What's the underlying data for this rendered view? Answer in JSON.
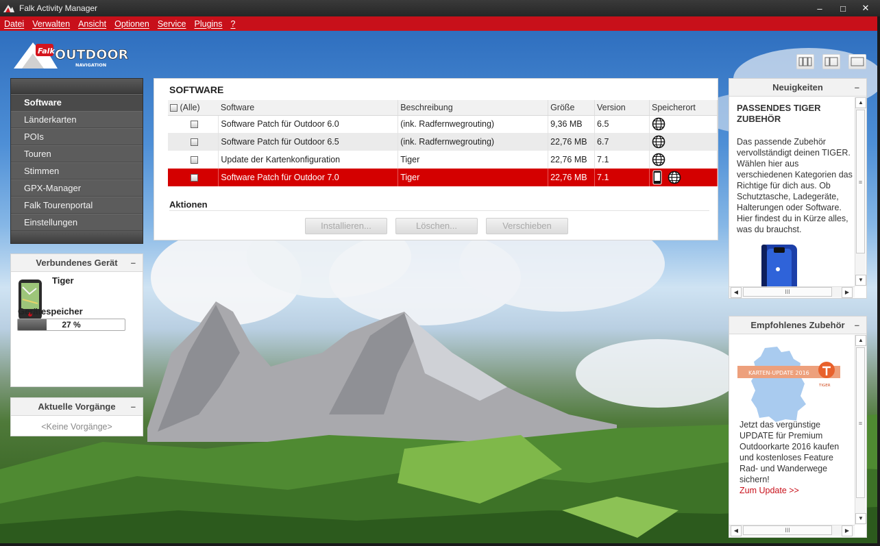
{
  "window": {
    "title": "Falk Activity Manager",
    "controls": [
      "–",
      "□",
      "✕"
    ]
  },
  "menu": [
    "Datei",
    "Verwalten",
    "Ansicht",
    "Optionen",
    "Service",
    "Plugins",
    "?"
  ],
  "logo": {
    "brand": "Falk",
    "name": "OUTDOOR",
    "sub": "NAVIGATION"
  },
  "nav": {
    "items": [
      "Software",
      "Länderkarten",
      "POIs",
      "Touren",
      "Stimmen",
      "GPX-Manager",
      "Falk Tourenportal",
      "Einstellungen"
    ],
    "active": "Software"
  },
  "device_panel": {
    "title": "Verbundenes Gerät",
    "collapse": "–",
    "device_name": "Tiger",
    "memory_label": "Gerätespeicher",
    "memory_used": 0.27,
    "memory_text": "27 %"
  },
  "process_panel": {
    "title": "Aktuelle Vorgänge",
    "collapse": "–",
    "empty_text": "<Keine Vorgänge>"
  },
  "software": {
    "heading": "SOFTWARE",
    "columns": {
      "all": "(Alle)",
      "software": "Software",
      "beschreibung": "Beschreibung",
      "groesse": "Größe",
      "version": "Version",
      "speicherort": "Speicherort"
    },
    "rows": [
      {
        "name": "Software Patch für Outdoor 6.0",
        "desc": "(ink. Radfernwegrouting)",
        "size": "9,36 MB",
        "version": "6.5",
        "location": [
          "globe"
        ]
      },
      {
        "name": "Software Patch für Outdoor 6.5",
        "desc": "(ink. Radfernwegrouting)",
        "size": "22,76 MB",
        "version": "6.7",
        "location": [
          "globe"
        ]
      },
      {
        "name": "Update der Kartenkonfiguration",
        "desc": "Tiger",
        "size": "22,76 MB",
        "version": "7.1",
        "location": [
          "globe"
        ]
      },
      {
        "name": "Software Patch für Outdoor 7.0",
        "desc": "Tiger",
        "size": "22,76 MB",
        "version": "7.1",
        "location": [
          "device",
          "globe"
        ],
        "selected": true
      }
    ],
    "actions_label": "Aktionen",
    "buttons": {
      "install": "Installieren...",
      "delete": "Löschen...",
      "move": "Verschieben"
    }
  },
  "news_panel": {
    "title": "Neuigkeiten",
    "collapse": "–",
    "headline": "PASSENDES TIGER ZUBEHÖR",
    "text": "Das passende Zubehör vervollständigt deinen TIGER. Wählen hier aus verschiedenen Kategorien das Richtige für dich aus. Ob Schutztasche, Ladegeräte, Halterungen oder Software. Hier findest du in Kürze alles, was du brauchst."
  },
  "accessory_panel": {
    "title": "Empfohlenes Zubehör",
    "collapse": "–",
    "banner": "KARTEN-UPDATE 2016",
    "banner_brand": "TIGER",
    "text": "Jetzt das vergünstige UPDATE für Premium Outdoorkarte 2016 kaufen und kostenloses Feature Rad- und Wanderwege sichern!",
    "link": "Zum Update >>"
  },
  "scrollbar": {
    "grip": "III",
    "grip_v": "≡"
  },
  "colors": {
    "accent": "#c8101a",
    "selected_row": "#d40000"
  }
}
